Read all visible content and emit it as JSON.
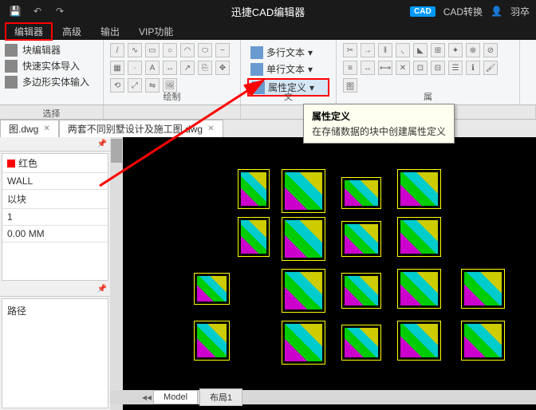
{
  "app_title": "迅捷CAD编辑器",
  "title_right": {
    "cad_badge": "CAD",
    "convert": "CAD转换",
    "user": "羽卒"
  },
  "menu": [
    "编辑器",
    "高级",
    "输出",
    "VIP功能"
  ],
  "ribbon_left": {
    "items": [
      "块编辑器",
      "快速实体导入",
      "多边形实体输入"
    ],
    "label": "选择"
  },
  "ribbon_draw_label": "绘制",
  "ribbon_text": {
    "items": [
      "多行文本",
      "单行文本",
      "属性定义"
    ],
    "label": "文"
  },
  "ribbon_right_label": "属",
  "tooltip": {
    "title": "属性定义",
    "desc": "在存储数据的块中创建属性定义"
  },
  "file_tabs": [
    "图.dwg",
    "两套不同别墅设计及施工图.dwg"
  ],
  "props": {
    "color": "红色",
    "layer": "WALL",
    "unit": "以块",
    "scale": "1",
    "size": "0.00 MM"
  },
  "path_label": "路径",
  "bottom_tabs": [
    "Model",
    "布局1"
  ]
}
